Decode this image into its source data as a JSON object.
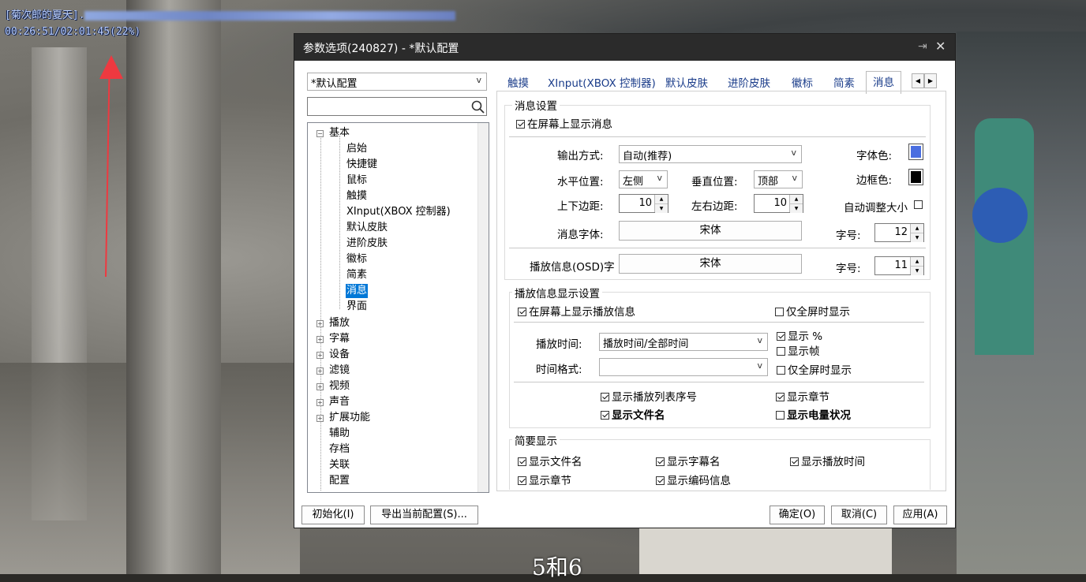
{
  "osd": {
    "title": "[菊次郎的夏天].",
    "time": "00:26:51/02:01:45(22%)"
  },
  "subtitle": "5和6",
  "dialog": {
    "title": "参数选项(240827) - *默认配置",
    "pin_icon": "pin-icon",
    "close_icon": "close-icon"
  },
  "profile": {
    "selected": "*默认配置"
  },
  "search": {
    "placeholder": "",
    "icon": "search-icon"
  },
  "tree": {
    "root": "基本",
    "children": [
      "启始",
      "快捷键",
      "鼠标",
      "触摸",
      "XInput(XBOX 控制器)",
      "默认皮肤",
      "进阶皮肤",
      "徽标",
      "简素",
      "消息",
      "界面"
    ],
    "selected": "消息",
    "groups": [
      "播放",
      "字幕",
      "设备",
      "滤镜",
      "视频",
      "声音",
      "扩展功能"
    ],
    "leaves": [
      "辅助",
      "存档",
      "关联",
      "配置"
    ]
  },
  "tabs": [
    "触摸",
    "XInput(XBOX 控制器)",
    "默认皮肤",
    "进阶皮肤",
    "徽标",
    "简素",
    "消息"
  ],
  "active_tab": "消息",
  "message_settings": {
    "group_title": "消息设置",
    "show_on_screen": {
      "label": "在屏幕上显示消息",
      "checked": true
    },
    "output_mode_label": "输出方式:",
    "output_mode_value": "自动(推荐)",
    "font_color_label": "字体色:",
    "font_color": "#4a6ee0",
    "h_pos_label": "水平位置:",
    "h_pos_value": "左侧",
    "v_pos_label": "垂直位置:",
    "v_pos_value": "顶部",
    "border_color_label": "边框色:",
    "border_color": "#000000",
    "tb_margin_label": "上下边距:",
    "tb_margin_value": "10",
    "lr_margin_label": "左右边距:",
    "lr_margin_value": "10",
    "auto_size": {
      "label": "自动调整大小",
      "checked": false
    },
    "msg_font_label": "消息字体:",
    "msg_font_value": "宋体",
    "font_size_label": "字号:",
    "msg_font_size": "12",
    "osd_font_label": "播放信息(OSD)字",
    "osd_font_value": "宋体",
    "osd_font_size": "11"
  },
  "playback_info": {
    "group_title": "播放信息显示设置",
    "show_on_screen": {
      "label": "在屏幕上显示播放信息",
      "checked": true
    },
    "fullscreen_only_top": {
      "label": "仅全屏时显示",
      "checked": false
    },
    "time_label": "播放时间:",
    "time_value": "播放时间/全部时间",
    "format_label": "时间格式:",
    "format_value": "",
    "show_percent": {
      "label": "显示 %",
      "checked": true
    },
    "show_frame": {
      "label": "显示帧",
      "checked": false
    },
    "fullscreen_only": {
      "label": "仅全屏时显示",
      "checked": false
    },
    "show_playlist_no": {
      "label": "显示播放列表序号",
      "checked": true
    },
    "show_chapter": {
      "label": "显示章节",
      "checked": true
    },
    "show_filename": {
      "label": "显示文件名",
      "checked": true
    },
    "show_battery": {
      "label": "显示电量状况",
      "checked": false
    }
  },
  "brief_display": {
    "group_title": "简要显示",
    "items": [
      {
        "label": "显示文件名",
        "checked": true
      },
      {
        "label": "显示字幕名",
        "checked": true
      },
      {
        "label": "显示播放时间",
        "checked": true
      },
      {
        "label": "显示章节",
        "checked": true
      },
      {
        "label": "显示编码信息",
        "checked": true
      }
    ]
  },
  "footer": {
    "init_button": "初始化(I)",
    "export_button": "导出当前配置(S)...",
    "ok_button": "确定(O)",
    "cancel_button": "取消(C)",
    "apply_button": "应用(A)"
  },
  "colors": {
    "accent": "#0078d7",
    "arrow": "#ee3940",
    "titlebar": "#2b2b2b"
  }
}
